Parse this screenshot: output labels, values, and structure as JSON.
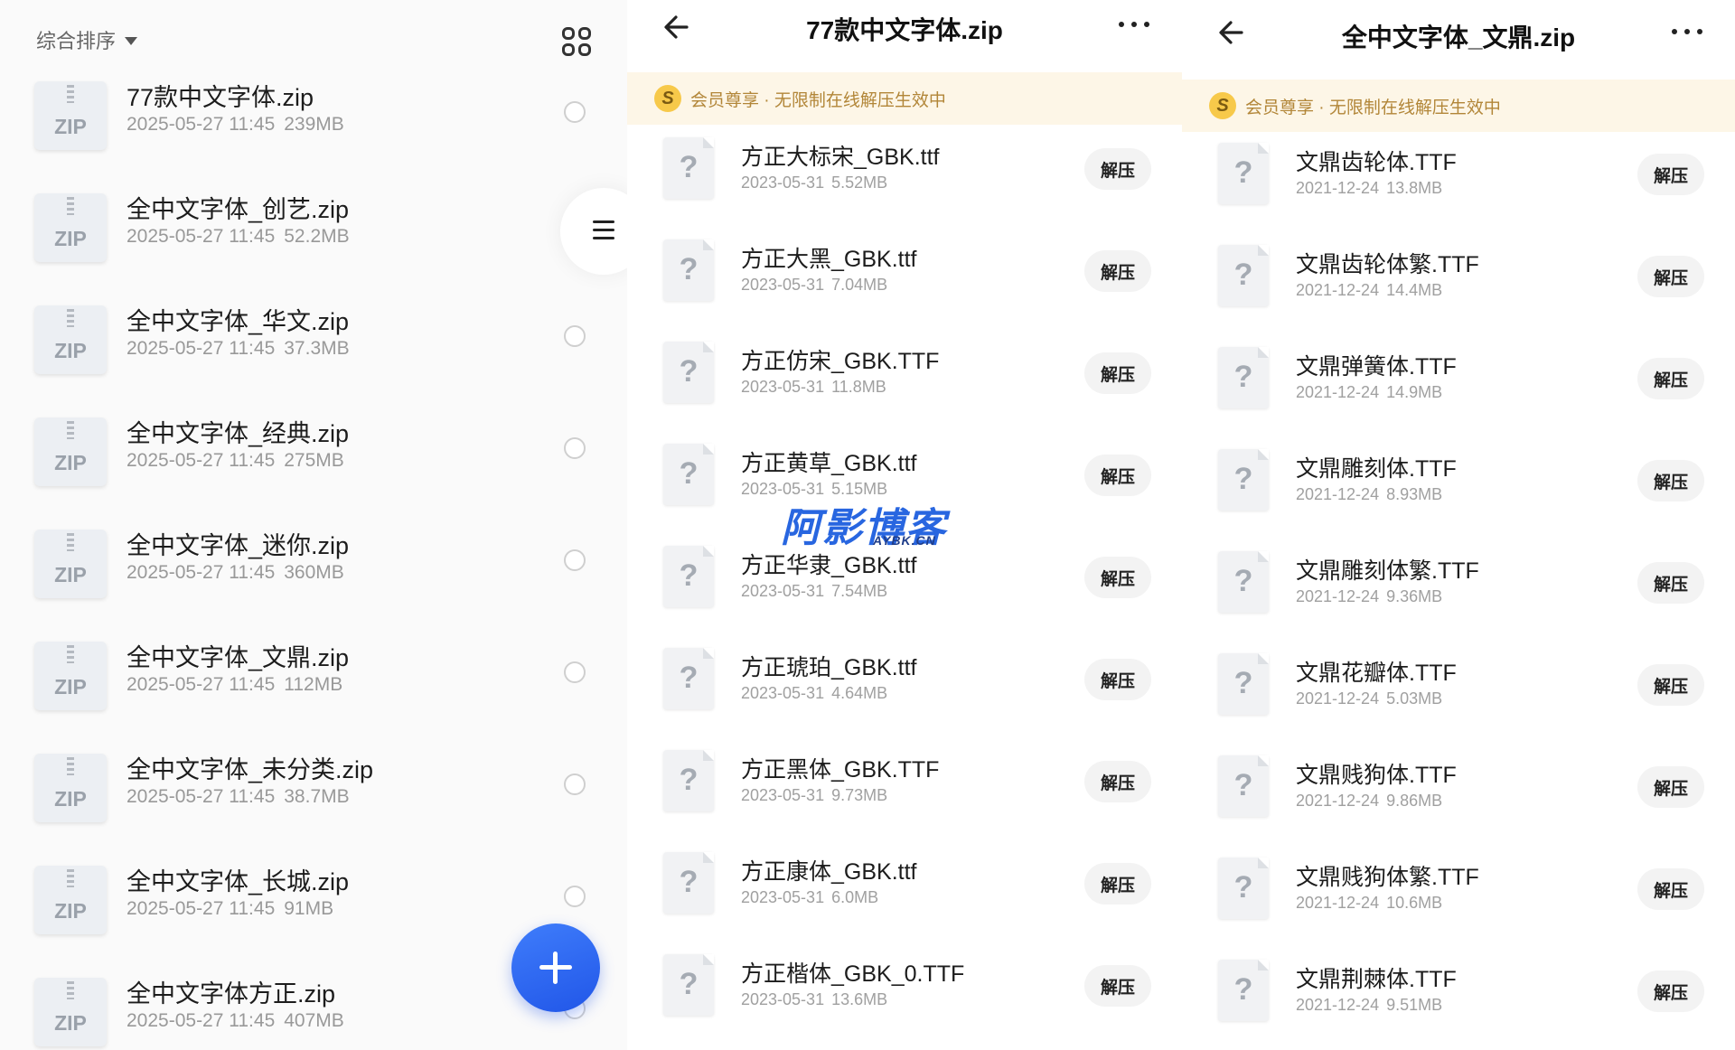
{
  "panel1": {
    "sort_label": "综合排序",
    "files": [
      {
        "name": "77款中文字体.zip",
        "date": "2025-05-27 11:45",
        "size": "239MB",
        "icon_label": "ZIP"
      },
      {
        "name": "全中文字体_创艺.zip",
        "date": "2025-05-27 11:45",
        "size": "52.2MB",
        "icon_label": "ZIP"
      },
      {
        "name": "全中文字体_华文.zip",
        "date": "2025-05-27 11:45",
        "size": "37.3MB",
        "icon_label": "ZIP"
      },
      {
        "name": "全中文字体_经典.zip",
        "date": "2025-05-27 11:45",
        "size": "275MB",
        "icon_label": "ZIP"
      },
      {
        "name": "全中文字体_迷你.zip",
        "date": "2025-05-27 11:45",
        "size": "360MB",
        "icon_label": "ZIP"
      },
      {
        "name": "全中文字体_文鼎.zip",
        "date": "2025-05-27 11:45",
        "size": "112MB",
        "icon_label": "ZIP"
      },
      {
        "name": "全中文字体_未分类.zip",
        "date": "2025-05-27 11:45",
        "size": "38.7MB",
        "icon_label": "ZIP"
      },
      {
        "name": "全中文字体_长城.zip",
        "date": "2025-05-27 11:45",
        "size": "91MB",
        "icon_label": "ZIP"
      },
      {
        "name": "全中文字体方正.zip",
        "date": "2025-05-27 11:45",
        "size": "407MB",
        "icon_label": "ZIP"
      }
    ]
  },
  "panel2": {
    "title": "77款中文字体.zip",
    "vip_coin": "S",
    "vip_text": "会员尊享 · 无限制在线解压生效中",
    "extract_label": "解压",
    "file_icon_glyph": "?",
    "files": [
      {
        "name": "方正大标宋_GBK.ttf",
        "date": "2023-05-31",
        "size": "5.52MB"
      },
      {
        "name": "方正大黑_GBK.ttf",
        "date": "2023-05-31",
        "size": "7.04MB"
      },
      {
        "name": "方正仿宋_GBK.TTF",
        "date": "2023-05-31",
        "size": "11.8MB"
      },
      {
        "name": "方正黄草_GBK.ttf",
        "date": "2023-05-31",
        "size": "5.15MB"
      },
      {
        "name": "方正华隶_GBK.ttf",
        "date": "2023-05-31",
        "size": "7.54MB"
      },
      {
        "name": "方正琥珀_GBK.ttf",
        "date": "2023-05-31",
        "size": "4.64MB"
      },
      {
        "name": "方正黑体_GBK.TTF",
        "date": "2023-05-31",
        "size": "9.73MB"
      },
      {
        "name": "方正康体_GBK.ttf",
        "date": "2023-05-31",
        "size": "6.0MB"
      },
      {
        "name": "方正楷体_GBK_0.TTF",
        "date": "2023-05-31",
        "size": "13.6MB"
      }
    ]
  },
  "panel3": {
    "title": "全中文字体_文鼎.zip",
    "vip_coin": "S",
    "vip_text": "会员尊享 · 无限制在线解压生效中",
    "extract_label": "解压",
    "file_icon_glyph": "?",
    "files": [
      {
        "name": "文鼎齿轮体.TTF",
        "date": "2021-12-24",
        "size": "13.8MB"
      },
      {
        "name": "文鼎齿轮体繁.TTF",
        "date": "2021-12-24",
        "size": "14.4MB"
      },
      {
        "name": "文鼎弹簧体.TTF",
        "date": "2021-12-24",
        "size": "14.9MB"
      },
      {
        "name": "文鼎雕刻体.TTF",
        "date": "2021-12-24",
        "size": "8.93MB"
      },
      {
        "name": "文鼎雕刻体繁.TTF",
        "date": "2021-12-24",
        "size": "9.36MB"
      },
      {
        "name": "文鼎花瓣体.TTF",
        "date": "2021-12-24",
        "size": "5.03MB"
      },
      {
        "name": "文鼎贱狗体.TTF",
        "date": "2021-12-24",
        "size": "9.86MB"
      },
      {
        "name": "文鼎贱狗体繁.TTF",
        "date": "2021-12-24",
        "size": "10.6MB"
      },
      {
        "name": "文鼎荆棘体.TTF",
        "date": "2021-12-24",
        "size": "9.51MB"
      }
    ]
  },
  "watermark": {
    "main": "阿影博客",
    "sub": "AYBK.CN"
  },
  "icons": {
    "sort_dropdown": "caret-down-icon",
    "view_toggle": "grid-view-icon",
    "menu": "hamburger-menu-icon",
    "fab": "plus-icon",
    "back": "arrow-left-icon",
    "more": "more-dots-icon",
    "zip_file": "zip-file-icon",
    "unknown_file": "unknown-file-icon"
  },
  "colors": {
    "accent": "#2866e0",
    "fab": "#2f6bf5",
    "vip_background": "#fdf6e7",
    "vip_text": "#b28638",
    "meta_text": "#999999"
  }
}
